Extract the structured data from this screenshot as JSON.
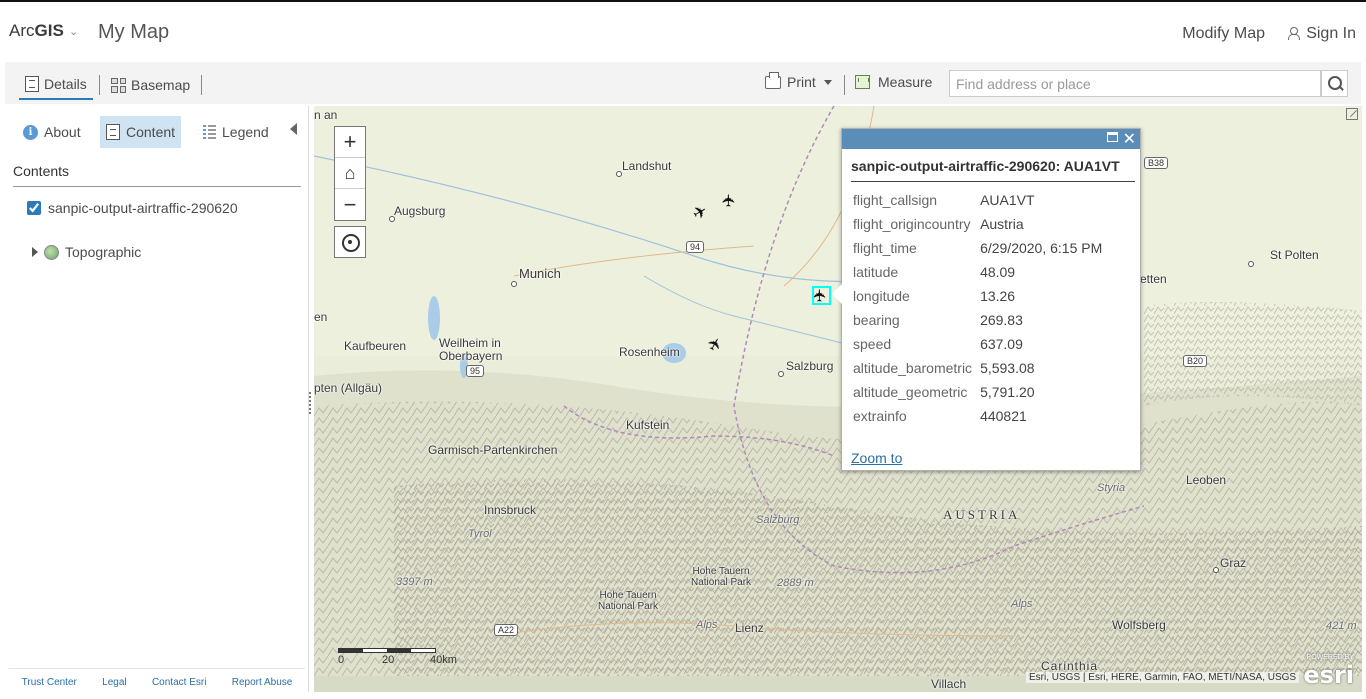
{
  "app": {
    "brand_light": "Arc",
    "brand_bold": "GIS",
    "map_title": "My Map"
  },
  "header": {
    "modify_map": "Modify Map",
    "sign_in": "Sign In"
  },
  "toolbar": {
    "details": "Details",
    "basemap": "Basemap",
    "print": "Print",
    "measure": "Measure",
    "search_placeholder": "Find address or place"
  },
  "panel": {
    "tabs": {
      "about": "About",
      "content": "Content",
      "legend": "Legend"
    },
    "contents_heading": "Contents",
    "layer_name": "sanpic-output-airtraffic-290620",
    "layer_checked": true,
    "basemap_name": "Topographic",
    "footer": [
      "Trust Center",
      "Legal",
      "Contact Esri",
      "Report Abuse"
    ]
  },
  "map": {
    "labels": {
      "landshut": "Landshut",
      "augsburg": "Augsburg",
      "munich": "Munich",
      "kaufbeuren": "Kaufbeuren",
      "weilheim": "Weilheim in\nOberbayern",
      "rosenheim": "Rosenheim",
      "salzburg": "Salzburg",
      "salzburg_region": "Salzburg",
      "kufstein": "Kufstein",
      "garmisch": "Garmisch-Partenkirchen",
      "innsbruck": "Innsbruck",
      "tyrol": "Tyrol",
      "hohe_tauern_1": "Hohe Tauern\nNational Park",
      "hohe_tauern_2": "Hohe Tauern\nNational Park",
      "lienz": "Lienz",
      "alps_1": "Alps",
      "alps_2": "Alps",
      "austria": "AUSTRIA",
      "styria": "Styria",
      "leoben": "Leoben",
      "graz": "Graz",
      "wolfsberg": "Wolfsberg",
      "st_polten": "St Polten",
      "carinthia": "Carinthia",
      "villach": "Villach",
      "kempten": "pten (Allgäu)",
      "edge_en": "en",
      "edge_an": "n an",
      "etten": "etten",
      "elev_1": "3397 m",
      "elev_2": "2889 m",
      "elev_3": "421 m"
    },
    "shields": {
      "r94": "94",
      "r95": "95",
      "a22": "A22",
      "b38": "B38",
      "b20": "B20"
    },
    "scale": {
      "s0": "0",
      "s20": "20",
      "s40": "40km"
    },
    "attribution": "Esri, USGS | Esri, HERE, Garmin, FAO, METI/NASA, USGS",
    "esri_powered": "POWERED BY",
    "esri_word": "esri"
  },
  "popup": {
    "title": "sanpic-output-airtraffic-290620: AUA1VT",
    "fields": [
      {
        "k": "flight_callsign",
        "v": "AUA1VT"
      },
      {
        "k": "flight_origincountry",
        "v": "Austria"
      },
      {
        "k": "flight_time",
        "v": "6/29/2020, 6:15 PM"
      },
      {
        "k": "latitude",
        "v": "48.09"
      },
      {
        "k": "longitude",
        "v": "13.26"
      },
      {
        "k": "bearing",
        "v": "269.83"
      },
      {
        "k": "speed",
        "v": "637.09"
      },
      {
        "k": "altitude_barometric",
        "v": "5,593.08"
      },
      {
        "k": "altitude_geometric",
        "v": "5,791.20"
      },
      {
        "k": "extrainfo",
        "v": "440821"
      }
    ],
    "zoom_to": "Zoom to"
  },
  "colors": {
    "accent": "#2b7bb9",
    "popup_bar": "#5b8db8",
    "selection": "#00ffff",
    "active_tab": "#cfe3f2"
  }
}
